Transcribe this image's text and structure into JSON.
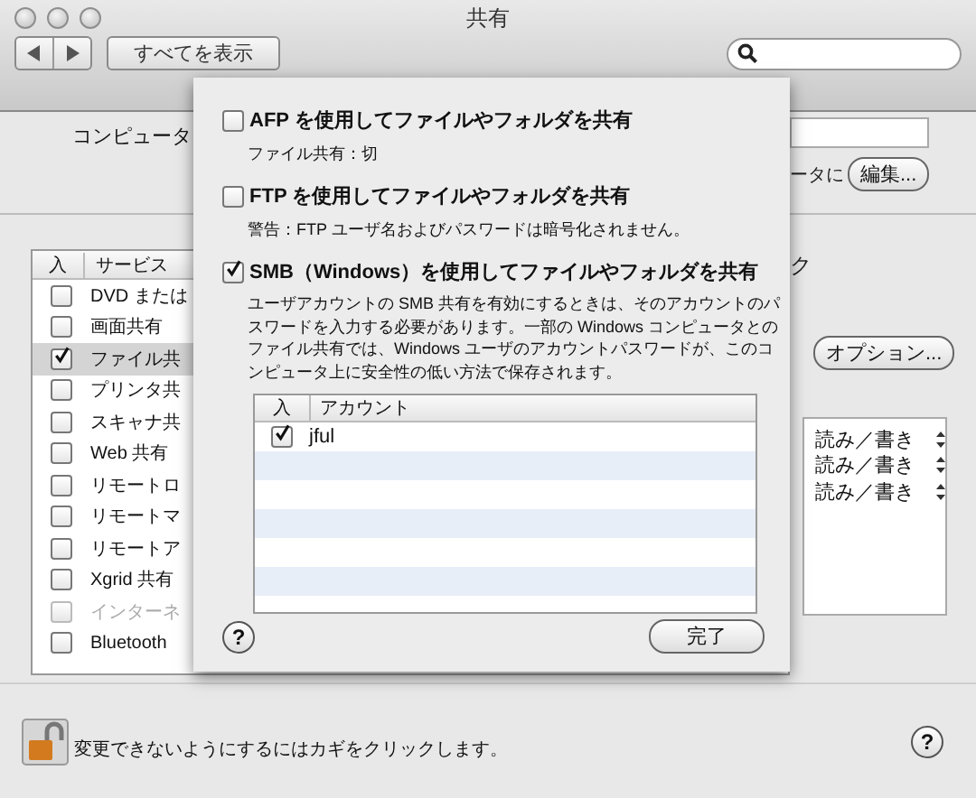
{
  "window": {
    "title": "共有"
  },
  "toolbar": {
    "show_all": "すべてを表示"
  },
  "computer_name": {
    "label": "コンピュータ",
    "note_fragment": "ータに",
    "edit_button": "編集..."
  },
  "services": {
    "columns": [
      "入",
      "サービス"
    ],
    "items": [
      {
        "name": "DVD または",
        "checked": false,
        "selected": false,
        "disabled": false
      },
      {
        "name": "画面共有",
        "checked": false,
        "selected": false,
        "disabled": false
      },
      {
        "name": "ファイル共",
        "checked": true,
        "selected": true,
        "disabled": false
      },
      {
        "name": "プリンタ共",
        "checked": false,
        "selected": false,
        "disabled": false
      },
      {
        "name": "スキャナ共",
        "checked": false,
        "selected": false,
        "disabled": false
      },
      {
        "name": "Web 共有",
        "checked": false,
        "selected": false,
        "disabled": false
      },
      {
        "name": "リモートロ",
        "checked": false,
        "selected": false,
        "disabled": false
      },
      {
        "name": "リモートマ",
        "checked": false,
        "selected": false,
        "disabled": false
      },
      {
        "name": "リモートア",
        "checked": false,
        "selected": false,
        "disabled": false
      },
      {
        "name": "Xgrid 共有",
        "checked": false,
        "selected": false,
        "disabled": false
      },
      {
        "name": "インターネ",
        "checked": false,
        "selected": false,
        "disabled": true
      },
      {
        "name": "Bluetooth",
        "checked": false,
        "selected": false,
        "disabled": false
      }
    ]
  },
  "status_fragment": "ク",
  "options_button": "オプション...",
  "permissions": [
    {
      "label": "読み／書き"
    },
    {
      "label": "読み／書き"
    },
    {
      "label": "読み／書き"
    }
  ],
  "sheet": {
    "options": [
      {
        "label": "AFP を使用してファイルやフォルダを共有",
        "checked": false,
        "note": "ファイル共有：切"
      },
      {
        "label": "FTP を使用してファイルやフォルダを共有",
        "checked": false,
        "note": "警告：FTP ユーザ名およびパスワードは暗号化されません。"
      },
      {
        "label": "SMB（Windows）を使用してファイルやフォルダを共有",
        "checked": true,
        "note": "ユーザアカウントの SMB 共有を有効にするときは、そのアカウントのパスワードを入力する必要があります。一部の Windows コンピュータとのファイル共有では、Windows ユーザのアカウントパスワードが、このコンピュータ上に安全性の低い方法で保存されます。"
      }
    ],
    "accounts": {
      "columns": [
        "入",
        "アカウント"
      ],
      "rows": [
        {
          "name": "jful",
          "checked": true
        }
      ]
    },
    "help_label": "?",
    "done_button": "完了"
  },
  "footer": {
    "lock_text": "変更できないようにするにはカギをクリックします。",
    "help_label": "?"
  }
}
